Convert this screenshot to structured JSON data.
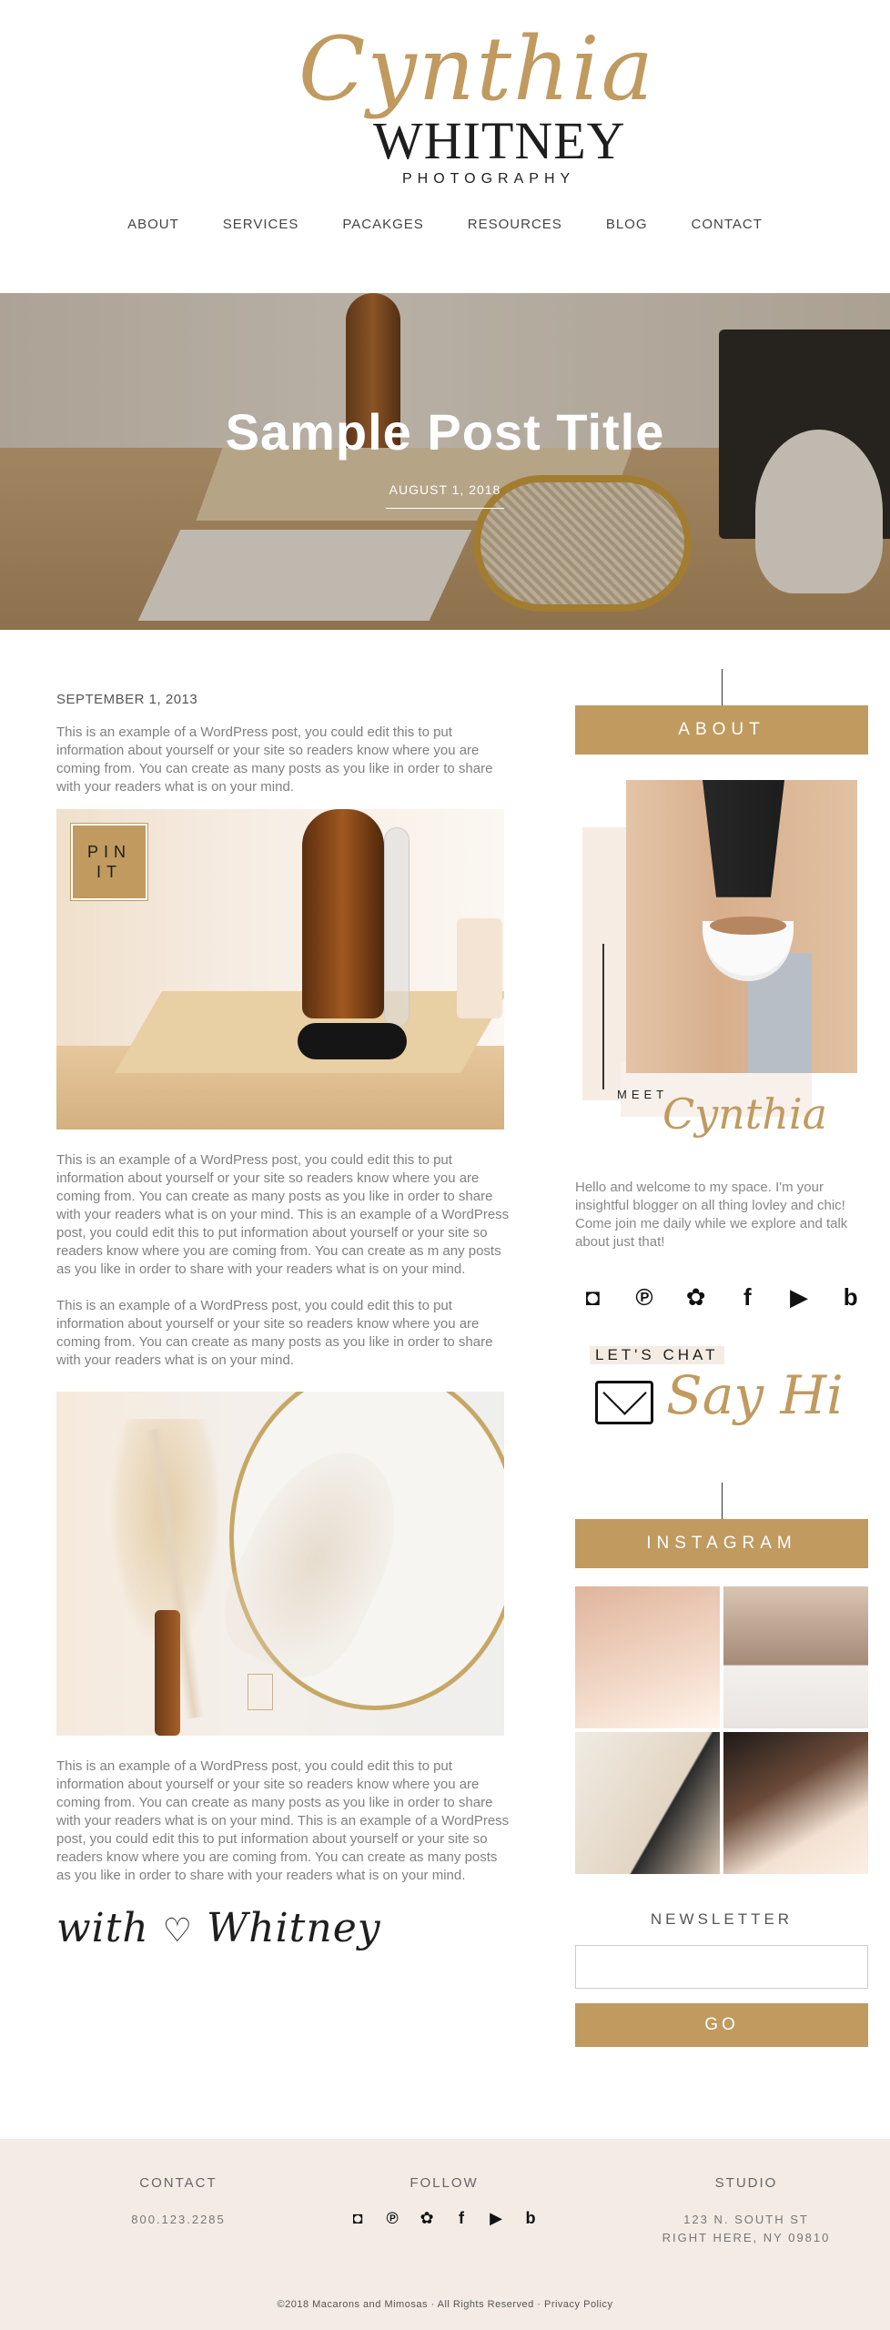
{
  "brand": {
    "script_name": "Cynthia",
    "name": "WHITNEY",
    "subtitle": "PHOTOGRAPHY",
    "accent_color": "#c09a5f"
  },
  "nav": {
    "items": [
      "ABOUT",
      "SERVICES",
      "PACAKGES",
      "RESOURCES",
      "BLOG",
      "CONTACT"
    ]
  },
  "hero": {
    "title": "Sample Post Title",
    "date": "AUGUST 1, 2018"
  },
  "post": {
    "date": "SEPTEMBER 1, 2013",
    "paragraphs": [
      "This is an example of a WordPress post, you could edit this to put information about yourself or your site so readers know where you are coming from. You can create as many posts as you like in order to share with your readers what is on your mind.",
      "This is an example of a WordPress post, you could edit this to put information about yourself or your site so readers know where you are coming from. You can create as many posts as you like in order to share with your readers what is on your mind. This is an example of a WordPress post, you could edit this to put information about yourself or your site so readers know where you are coming from. You can create as m any posts as you like in order to share with your readers what is on your mind.",
      "This is an example of a WordPress post, you could edit this to put information about yourself or your site so readers know where you are coming from. You can create as many posts as you like in order to share with your readers what is on your mind.",
      "This is an example of a WordPress post, you could edit this to put information about yourself or your site so readers know where you are coming from. You can create as many posts as you like in order to share with your readers what is on your mind. This is an example of a WordPress post, you could edit this to put information about yourself or your site so readers know where you are coming from. You can create as many posts as you like in order to share with your readers what is on your mind."
    ],
    "pin_label_1": "PIN",
    "pin_label_2": "IT",
    "signature_1": "with",
    "signature_heart": "♡",
    "signature_2": "Whitney"
  },
  "sidebar": {
    "about_heading": "ABOUT",
    "meet_label": "MEET",
    "meet_script": "Cynthia",
    "about_text": "Hello and welcome to my space. I'm your insightful blogger on all thing lovley and chic! Come join me daily while we explore and talk about just that!",
    "socials": [
      "instagram-icon",
      "pinterest-icon",
      "bloglovin-circle-icon",
      "facebook-icon",
      "youtube-icon",
      "bloglovin-icon"
    ],
    "social_glyphs": {
      "instagram": "◘",
      "pinterest": "℗",
      "circle": "✿",
      "facebook": "f",
      "youtube": "▶",
      "bloglovin": "b"
    },
    "chat_label": "LET'S CHAT",
    "chat_script": "Say Hi",
    "instagram_heading": "INSTAGRAM",
    "newsletter_heading": "NEWSLETTER",
    "newsletter_button": "GO"
  },
  "footer": {
    "contact_title": "CONTACT",
    "contact_phone": "800.123.2285",
    "follow_title": "FOLLOW",
    "studio_title": "STUDIO",
    "studio_line1": "123 N. SOUTH ST",
    "studio_line2": "RIGHT HERE, NY 09810",
    "copyright": "©2018 Macarons and Mimosas  ·  All Rights Reserved  ·  Privacy Policy"
  }
}
